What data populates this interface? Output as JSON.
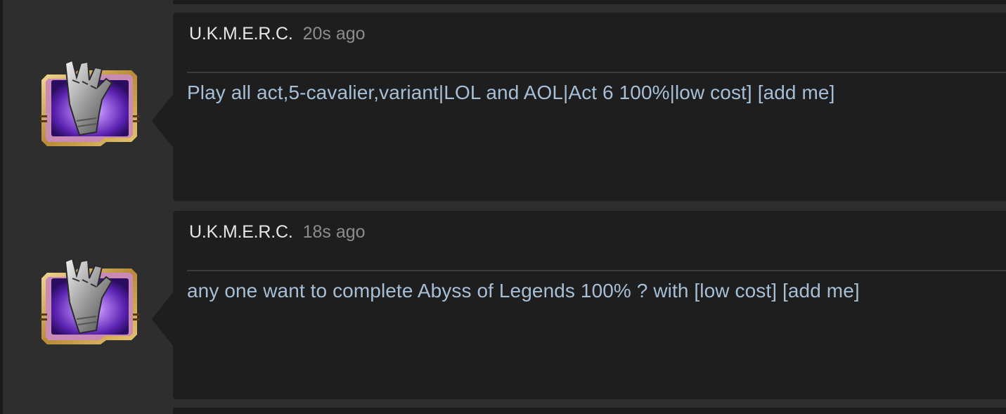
{
  "messages": [
    {
      "username": "U.K.M.E.R.C.",
      "timestamp": "20s ago",
      "text": "Play all act,5-cavalier,variant|LOL and AOL|Act 6 100%|low cost] [add me]",
      "avatar_icon": "gauntlet-icon"
    },
    {
      "username": "U.K.M.E.R.C.",
      "timestamp": "18s ago",
      "text": "any one want to complete Abyss of Legends 100% ? with [low cost] [add me]",
      "avatar_icon": "gauntlet-icon"
    }
  ],
  "colors": {
    "background": "#2e2e2e",
    "bubble": "#1e1e1e",
    "username": "#e6e6e6",
    "timestamp": "#8c8c8c",
    "message_text": "#a6bfd6",
    "avatar_frame_gold": "#c9a24a",
    "avatar_frame_pink": "#c98ab6",
    "avatar_glow_purple": "#7b3fd0"
  }
}
